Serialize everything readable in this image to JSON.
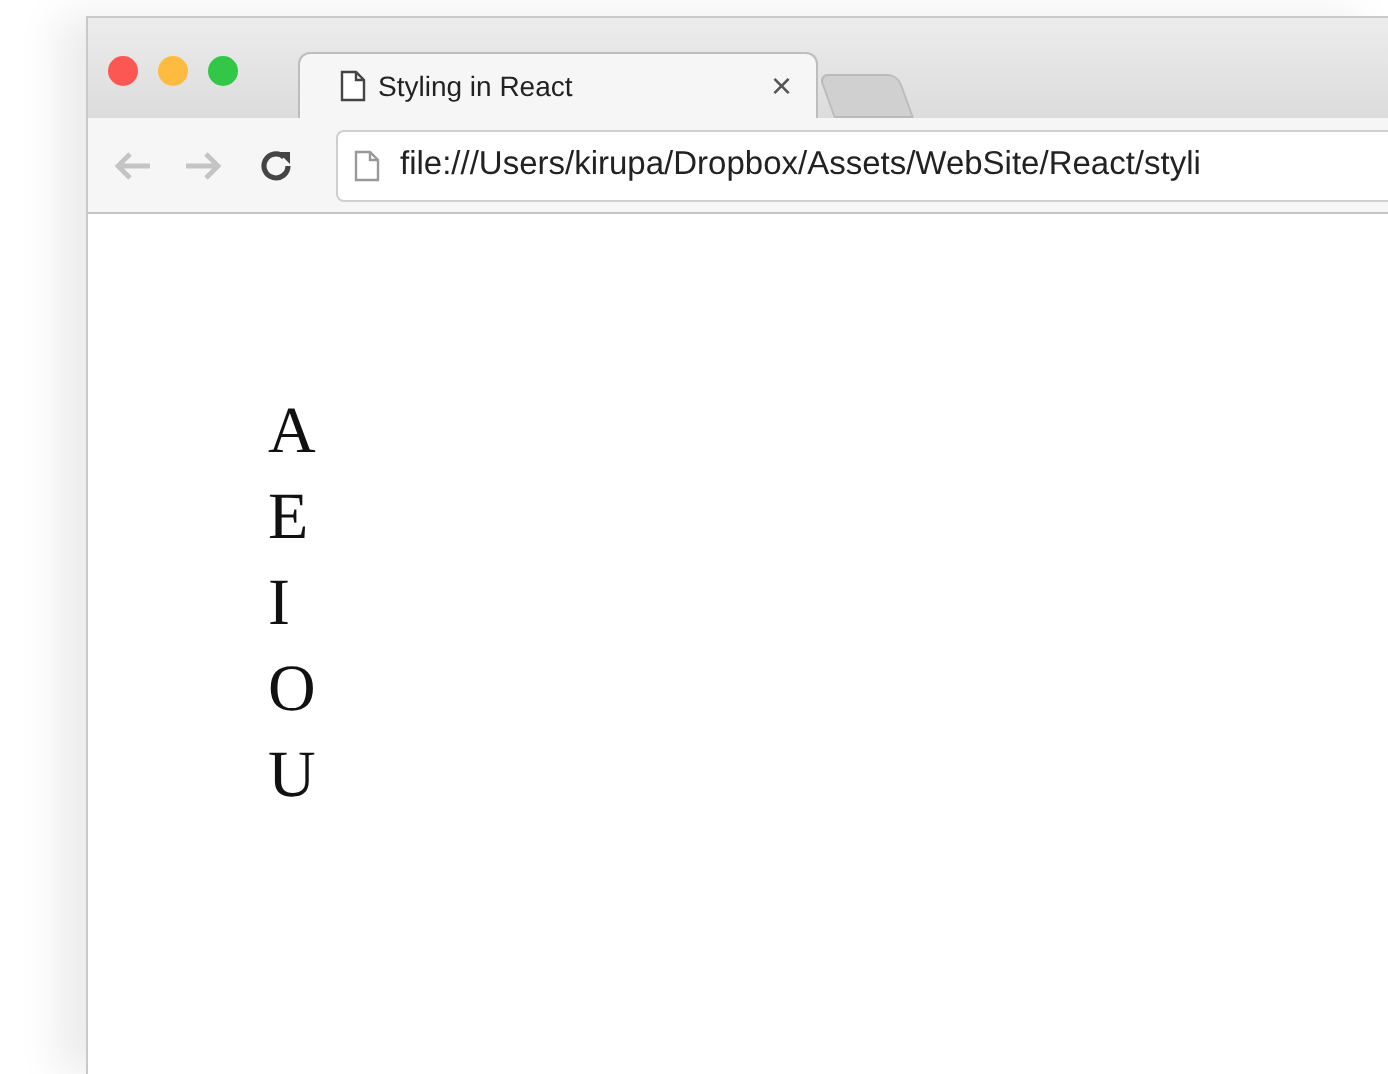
{
  "window": {
    "controls": [
      {
        "color": "#fc5753"
      },
      {
        "color": "#fdbc40"
      },
      {
        "color": "#33c748"
      }
    ]
  },
  "tabs": [
    {
      "label": "Styling in React",
      "close": "×",
      "selected": true
    }
  ],
  "toolbar": {
    "back": {
      "disabled": true
    },
    "forward": {
      "disabled": true
    },
    "address": "file:///Users/kirupa/Dropbox/Assets/WebSite/React/styli"
  },
  "content": {
    "letters": [
      "A",
      "E",
      "I",
      "O",
      "U"
    ]
  }
}
